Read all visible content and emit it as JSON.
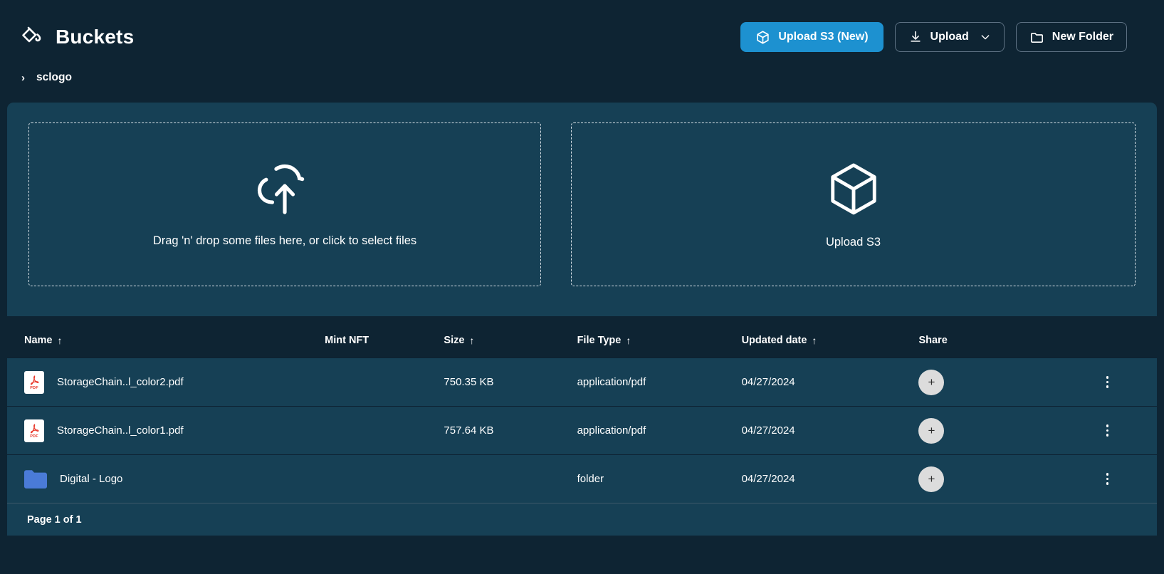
{
  "header": {
    "logo_icon": "paint-bucket-icon",
    "title": "Buckets",
    "buttons": {
      "upload_s3_new": {
        "label": "Upload S3 (New)",
        "icon": "cube-icon",
        "color": "#1d91d0"
      },
      "upload": {
        "label": "Upload",
        "icon": "download-icon",
        "chevron": "chevron-down-icon"
      },
      "new_folder": {
        "label": "New Folder",
        "icon": "folder-outline-icon"
      }
    }
  },
  "breadcrumb": {
    "arrow": "›",
    "label": "sclogo"
  },
  "upload_panel": {
    "dropzone": {
      "icon": "cloud-upload-icon",
      "text": "Drag 'n' drop some files here, or click to select files"
    },
    "s3": {
      "icon": "cube-icon",
      "text": "Upload S3"
    }
  },
  "table": {
    "columns": [
      {
        "label": "Name",
        "sortable": true,
        "sort_icon": "↑"
      },
      {
        "label": "Mint NFT",
        "sortable": false,
        "sort_icon": ""
      },
      {
        "label": "Size",
        "sortable": true,
        "sort_icon": "↑"
      },
      {
        "label": "File Type",
        "sortable": true,
        "sort_icon": "↑"
      },
      {
        "label": "Updated date",
        "sortable": true,
        "sort_icon": "↑"
      },
      {
        "label": "Share",
        "sortable": false,
        "sort_icon": ""
      }
    ],
    "rows": [
      {
        "icon": "pdf-file-icon",
        "name": "StorageChain..l_color2.pdf",
        "mint_nft": "",
        "size": "750.35 KB",
        "file_type": "application/pdf",
        "updated_date": "04/27/2024",
        "share_label": "+",
        "menu_icon": "kebab-menu-icon"
      },
      {
        "icon": "pdf-file-icon",
        "name": "StorageChain..l_color1.pdf",
        "mint_nft": "",
        "size": "757.64 KB",
        "file_type": "application/pdf",
        "updated_date": "04/27/2024",
        "share_label": "+",
        "menu_icon": "kebab-menu-icon"
      },
      {
        "icon": "folder-icon",
        "name": "Digital - Logo",
        "mint_nft": "",
        "size": "",
        "file_type": "folder",
        "updated_date": "04/27/2024",
        "share_label": "+",
        "menu_icon": "kebab-menu-icon"
      }
    ],
    "footer": {
      "page_label": "Page 1 of 1"
    }
  },
  "colors": {
    "page_background": "#0e2433",
    "panel_background": "#164055",
    "accent_blue": "#1d91d0",
    "folder_blue": "#4a7bd8",
    "pdf_red": "#e8392c",
    "share_button": "#dcdcdc"
  }
}
